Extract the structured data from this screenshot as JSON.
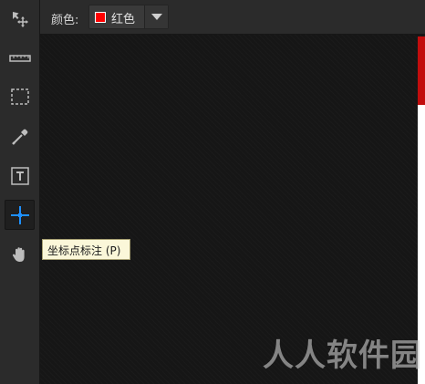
{
  "toolbar": {
    "tools": [
      {
        "name": "move-tool",
        "icon": "move-arrows-icon"
      },
      {
        "name": "ruler-tool",
        "icon": "ruler-icon"
      },
      {
        "name": "select-rect-tool",
        "icon": "dashed-rectangle-icon"
      },
      {
        "name": "color-picker-tool",
        "icon": "eyedropper-icon"
      },
      {
        "name": "text-tool",
        "icon": "text-box-icon"
      },
      {
        "name": "coordinate-mark-tool",
        "icon": "crosshair-icon",
        "active": true
      },
      {
        "name": "hand-tool",
        "icon": "hand-icon"
      }
    ]
  },
  "options": {
    "color_label": "颜色:",
    "selected_color": "红色",
    "selected_color_hex": "#ff0000"
  },
  "tooltip": {
    "text": "坐标点标注 (P)"
  },
  "watermark": {
    "text": "人人软件园"
  },
  "colors": {
    "accent": "#1e90ff",
    "panel": "#2b2b2b",
    "canvas": "#161616"
  }
}
